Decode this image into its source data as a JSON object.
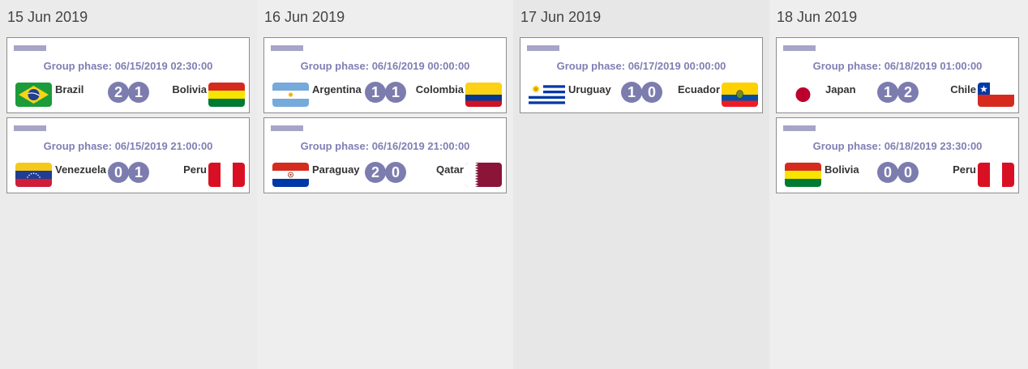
{
  "days": [
    {
      "date": "15 Jun 2019",
      "matches": [
        {
          "phase": "Group phase: 06/15/2019 02:30:00",
          "home": "Brazil",
          "away": "Bolivia",
          "home_score": "2",
          "away_score": "1",
          "home_flag": "brazil-flag-icon",
          "away_flag": "bolivia-flag-icon"
        },
        {
          "phase": "Group phase: 06/15/2019 21:00:00",
          "home": "Venezuela",
          "away": "Peru",
          "home_score": "0",
          "away_score": "1",
          "home_flag": "venezuela-flag-icon",
          "away_flag": "peru-flag-icon"
        }
      ]
    },
    {
      "date": "16 Jun 2019",
      "matches": [
        {
          "phase": "Group phase: 06/16/2019 00:00:00",
          "home": "Argentina",
          "away": "Colombia",
          "home_score": "1",
          "away_score": "1",
          "home_flag": "argentina-flag-icon",
          "away_flag": "colombia-flag-icon"
        },
        {
          "phase": "Group phase: 06/16/2019 21:00:00",
          "home": "Paraguay",
          "away": "Qatar",
          "home_score": "2",
          "away_score": "0",
          "home_flag": "paraguay-flag-icon",
          "away_flag": "qatar-flag-icon"
        }
      ]
    },
    {
      "date": "17 Jun 2019",
      "matches": [
        {
          "phase": "Group phase: 06/17/2019 00:00:00",
          "home": "Uruguay",
          "away": "Ecuador",
          "home_score": "1",
          "away_score": "0",
          "home_flag": "uruguay-flag-icon",
          "away_flag": "ecuador-flag-icon"
        }
      ]
    },
    {
      "date": "18 Jun 2019",
      "matches": [
        {
          "phase": "Group phase: 06/18/2019 01:00:00",
          "home": "Japan",
          "away": "Chile",
          "home_score": "1",
          "away_score": "2",
          "home_flag": "japan-flag-icon",
          "away_flag": "chile-flag-icon"
        },
        {
          "phase": "Group phase: 06/18/2019 23:30:00",
          "home": "Bolivia",
          "away": "Peru",
          "home_score": "0",
          "away_score": "0",
          "home_flag": "bolivia-flag-icon",
          "away_flag": "peru-flag-icon"
        }
      ]
    }
  ],
  "colors": {
    "score_badge": "#7d7cae",
    "phase_text": "#7f7fb4",
    "tag": "#a6a5c7"
  }
}
